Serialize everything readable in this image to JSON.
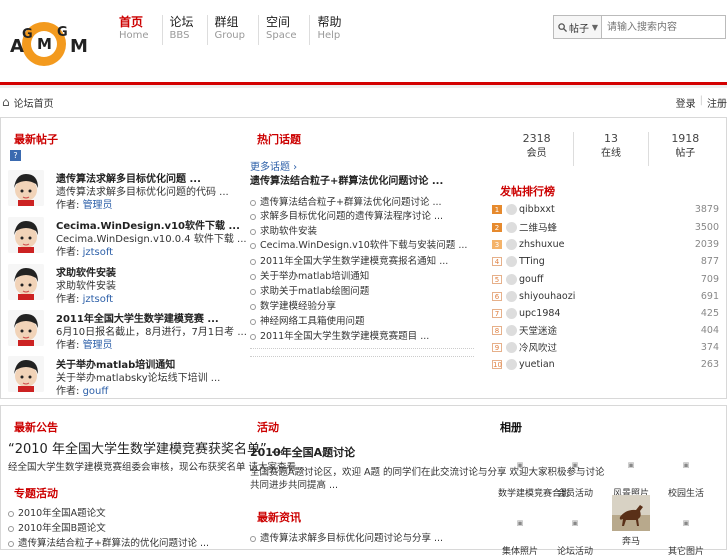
{
  "logo_text": "AGMGM",
  "nav": [
    {
      "cn": "首页",
      "en": "Home"
    },
    {
      "cn": "论坛",
      "en": "BBS"
    },
    {
      "cn": "群组",
      "en": "Group"
    },
    {
      "cn": "空间",
      "en": "Space"
    },
    {
      "cn": "帮助",
      "en": "Help"
    }
  ],
  "search": {
    "select_label": "帖子",
    "placeholder": "请输入搜索内容"
  },
  "breadcrumb": {
    "label": "论坛首页",
    "right": [
      "登录",
      "注册"
    ]
  },
  "colors": {
    "accent": "#cc0000",
    "link": "#2c5fa8"
  },
  "section_titles": {
    "hot_posts": "最新帖子",
    "hot_topics": "热门话题",
    "rank": "发帖排行榜",
    "announce": "最新公告",
    "notice": "活动",
    "albums": "相册",
    "activity": "专题活动",
    "news": "最新资讯"
  },
  "posts": [
    {
      "title": "遗传算法求解多目标优化问题 ...",
      "summary": "遗传算法求解多目标优化问题的代码 ...",
      "author_label": "作者:",
      "author": "管理员"
    },
    {
      "title": "Cecima.WinDesign.v10软件下载 ...",
      "summary": "Cecima.WinDesign.v10.0.4 软件下载 ...",
      "author_label": "作者:",
      "author": "jztsoft"
    },
    {
      "title": "求助软件安装",
      "summary": "求助软件安装",
      "author_label": "作者:",
      "author": "jztsoft"
    },
    {
      "title": "2011年全国大学生数学建模竞赛 ...",
      "summary": "6月10日报名截止，8月进行，7月1日考 ...",
      "author_label": "作者:",
      "author": "管理员"
    },
    {
      "title": "关于举办matlab培训通知",
      "summary": "关于举办matlabsky论坛线下培训 ...",
      "author_label": "作者:",
      "author": "gouff"
    }
  ],
  "middle": {
    "more": "更多话题 ›",
    "headline": "遗传算法结合粒子+群算法优化问题讨论 ...",
    "links": [
      "遗传算法结合粒子+群算法优化问题讨论 ...",
      "求解多目标优化问题的遗传算法程序讨论 ...",
      "求助软件安装",
      "Cecima.WinDesign.v10软件下载与安装问题 ...",
      "2011年全国大学生数学建模竞赛报名通知 ...",
      "关于举办matlab培训通知",
      "求助关于matlab绘图问题",
      "数学建模经验分享",
      "神经网络工具箱使用问题",
      "2011年全国大学生数学建模竞赛题目 ..."
    ]
  },
  "stats": [
    {
      "n": "2318",
      "l": "会员"
    },
    {
      "n": "13",
      "l": "在线"
    },
    {
      "n": "1918",
      "l": "帖子"
    }
  ],
  "rank": [
    {
      "num": "1",
      "name": "qibbxxt",
      "count": "3879"
    },
    {
      "num": "2",
      "name": "二维马蜂",
      "count": "3500"
    },
    {
      "num": "3",
      "name": "zhshuxue",
      "count": "2039"
    },
    {
      "num": "4",
      "name": "TTing",
      "count": "877"
    },
    {
      "num": "5",
      "name": "gouff",
      "count": "709"
    },
    {
      "num": "6",
      "name": "shiyouhaozi",
      "count": "691"
    },
    {
      "num": "7",
      "name": "upc1984",
      "count": "425"
    },
    {
      "num": "8",
      "name": "天堂迷途",
      "count": "404"
    },
    {
      "num": "9",
      "name": "冷风吹过",
      "count": "374"
    },
    {
      "num": "10",
      "name": "yuetian",
      "count": "263"
    }
  ],
  "announce": {
    "big": "“2010 年全国大学生数学建模竞赛获奖名单” ...",
    "desc": "经全国大学生数学建模竞赛组委会审核，现公布获奖名单 请大家查看 ...",
    "links": [
      "2010年全国A题论文",
      "2010年全国B题论文",
      "遗传算法结合粒子+群算法的优化问题讨论 ..."
    ]
  },
  "notice": {
    "title": "2010年全国A题讨论",
    "desc1": "全国赛题A题讨论区，欢迎 A题 的同学们在此交流讨论与分享 欢迎大家积极参与讨论",
    "desc2": "共同进步共同提高 ...",
    "link": "遗传算法求解多目标优化问题讨论与分享 ..."
  },
  "albums": [
    {
      "cap": "数学建模竞赛合影"
    },
    {
      "cap": "会员活动"
    },
    {
      "cap": "风景照片"
    },
    {
      "cap": "校园生活"
    },
    {
      "cap": "集体照片"
    },
    {
      "cap": "论坛活动"
    },
    {
      "cap": "奔马"
    },
    {
      "cap": "其它图片"
    }
  ]
}
